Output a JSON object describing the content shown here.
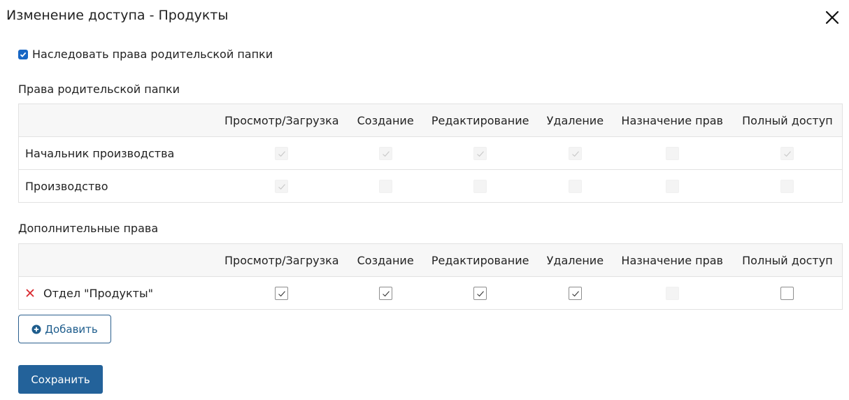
{
  "dialog": {
    "title": "Изменение доступа - Продукты",
    "close_icon": "close-icon"
  },
  "inherit": {
    "checked": true,
    "label": "Наследовать права родительской папки"
  },
  "columns": [
    "Просмотр/Загрузка",
    "Создание",
    "Редактирование",
    "Удаление",
    "Назначение прав",
    "Полный доступ"
  ],
  "parent_rights": {
    "title": "Права родительской папки",
    "rows": [
      {
        "name": "Начальник производства",
        "perms": [
          true,
          true,
          true,
          true,
          false,
          true
        ]
      },
      {
        "name": "Производство",
        "perms": [
          true,
          false,
          false,
          false,
          false,
          false
        ]
      }
    ]
  },
  "additional_rights": {
    "title": "Дополнительные права",
    "rows": [
      {
        "name": "Отдел \"Продукты\"",
        "perms": [
          true,
          true,
          true,
          true,
          null,
          false
        ]
      }
    ]
  },
  "buttons": {
    "add_label": "Добавить",
    "save_label": "Сохранить"
  },
  "colors": {
    "accent": "#23629a",
    "checkbox_blue": "#1766c4",
    "remove_red": "#d9262c"
  }
}
